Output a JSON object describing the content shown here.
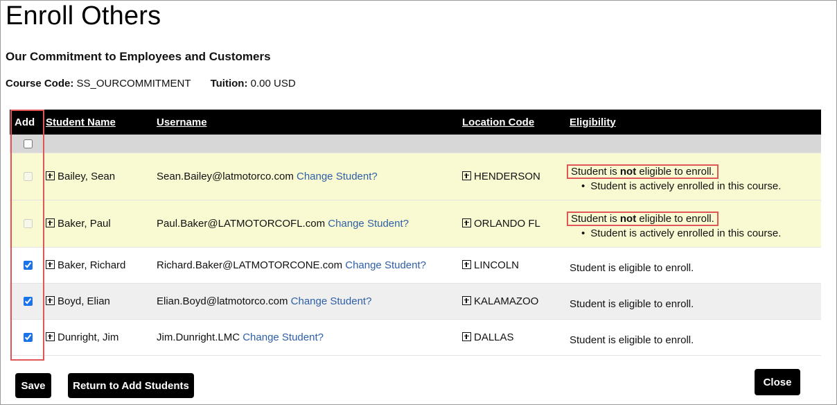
{
  "page": {
    "title": "Enroll Others",
    "course_title": "Our Commitment to Employees and Customers",
    "course_code_label": "Course Code:",
    "course_code": "SS_OURCOMMITMENT",
    "tuition_label": "Tuition:",
    "tuition": "0.00 USD"
  },
  "table": {
    "headers": {
      "add": "Add",
      "student_name": "Student Name",
      "username": "Username",
      "location_code": "Location Code",
      "eligibility": "Eligibility"
    },
    "change_link": "Change Student?",
    "rows": [
      {
        "checked": false,
        "disabled": true,
        "name": "Bailey, Sean",
        "username": "Sean.Bailey@latmotorco.com",
        "location": "HENDERSON",
        "elig_prefix": "Student is",
        "elig_not": "not",
        "elig_suffix": "eligible to enroll.",
        "reason": "Student is actively enrolled in this course."
      },
      {
        "checked": false,
        "disabled": true,
        "name": "Baker, Paul",
        "username": "Paul.Baker@LATMOTORCOFL.com",
        "location": "ORLANDO FL",
        "elig_prefix": "Student is",
        "elig_not": "not",
        "elig_suffix": "eligible to enroll.",
        "reason": "Student is actively enrolled in this course."
      },
      {
        "checked": true,
        "disabled": false,
        "name": "Baker, Richard",
        "username": "Richard.Baker@LATMOTORCONE.com",
        "location": "LINCOLN",
        "eligibility": "Student is eligible to enroll."
      },
      {
        "checked": true,
        "disabled": false,
        "name": "Boyd, Elian",
        "username": "Elian.Boyd@latmotorco.com",
        "location": "KALAMAZOO",
        "eligibility": "Student is eligible to enroll."
      },
      {
        "checked": true,
        "disabled": false,
        "name": "Dunright, Jim",
        "username": "Jim.Dunright.LMC",
        "location": "DALLAS",
        "eligibility": "Student is eligible to enroll."
      }
    ]
  },
  "buttons": {
    "save": "Save",
    "return": "Return to Add Students",
    "close": "Close"
  },
  "colors": {
    "header_bg": "#000000",
    "ineligible_row_bg": "#fafad2",
    "link": "#2d5fa8",
    "highlight_border": "#e05555"
  }
}
